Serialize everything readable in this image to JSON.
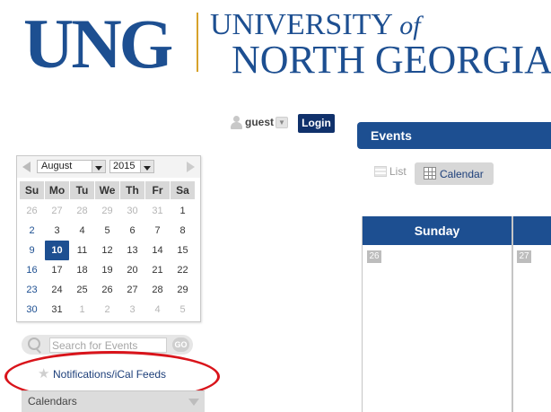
{
  "logo": {
    "abbr": "UNG",
    "line1_main": "UNIVERSITY",
    "line1_of": "of",
    "line2": "NORTH GEORGIA",
    "trademark": "™"
  },
  "user": {
    "name": "guest",
    "login_label": "Login"
  },
  "mini_calendar": {
    "month": "August",
    "year": "2015",
    "weekdays": [
      "Su",
      "Mo",
      "Tu",
      "We",
      "Th",
      "Fr",
      "Sa"
    ],
    "weeks": [
      [
        "26",
        "27",
        "28",
        "29",
        "30",
        "31",
        "1"
      ],
      [
        "2",
        "3",
        "4",
        "5",
        "6",
        "7",
        "8"
      ],
      [
        "9",
        "10",
        "11",
        "12",
        "13",
        "14",
        "15"
      ],
      [
        "16",
        "17",
        "18",
        "19",
        "20",
        "21",
        "22"
      ],
      [
        "23",
        "24",
        "25",
        "26",
        "27",
        "28",
        "29"
      ],
      [
        "30",
        "31",
        "1",
        "2",
        "3",
        "4",
        "5"
      ]
    ],
    "today": "10"
  },
  "search": {
    "placeholder": "Search for Events",
    "go_label": "GO"
  },
  "notifications": {
    "label": "Notifications/iCal Feeds"
  },
  "calendars_panel": {
    "label": "Calendars"
  },
  "events": {
    "title": "Events",
    "view_list": "List",
    "view_calendar": "Calendar",
    "column_sunday": "Sunday",
    "day_sunday": "26",
    "day_monday": "27"
  },
  "colors": {
    "brand_blue": "#1d4f91",
    "login_navy": "#10316b",
    "logo_gold": "#d7a22a",
    "highlight_red": "#d9141b"
  }
}
